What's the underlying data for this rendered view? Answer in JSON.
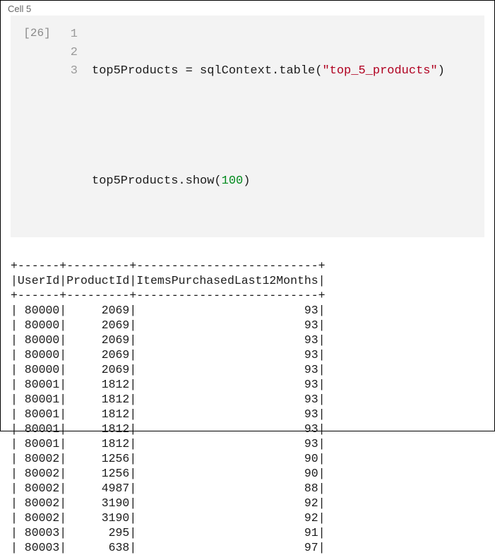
{
  "cell": {
    "title": "Cell 5",
    "exec_count": "[26]",
    "code": {
      "line1_prefix": "top5Products = sqlContext.table(",
      "line1_str": "\"top_5_products\"",
      "line1_suffix": ")",
      "line3_prefix": "top5Products.show(",
      "line3_num": "100",
      "line3_suffix": ")"
    }
  },
  "output_table": {
    "columns": [
      "UserId",
      "ProductId",
      "ItemsPurchasedLast12Months"
    ],
    "widths": [
      6,
      9,
      26
    ],
    "rows": [
      [
        80000,
        2069,
        93
      ],
      [
        80000,
        2069,
        93
      ],
      [
        80000,
        2069,
        93
      ],
      [
        80000,
        2069,
        93
      ],
      [
        80000,
        2069,
        93
      ],
      [
        80001,
        1812,
        93
      ],
      [
        80001,
        1812,
        93
      ],
      [
        80001,
        1812,
        93
      ],
      [
        80001,
        1812,
        93
      ],
      [
        80001,
        1812,
        93
      ],
      [
        80002,
        1256,
        90
      ],
      [
        80002,
        1256,
        90
      ],
      [
        80002,
        4987,
        88
      ],
      [
        80002,
        3190,
        92
      ],
      [
        80002,
        3190,
        92
      ],
      [
        80003,
        295,
        91
      ],
      [
        80003,
        638,
        97
      ]
    ]
  }
}
